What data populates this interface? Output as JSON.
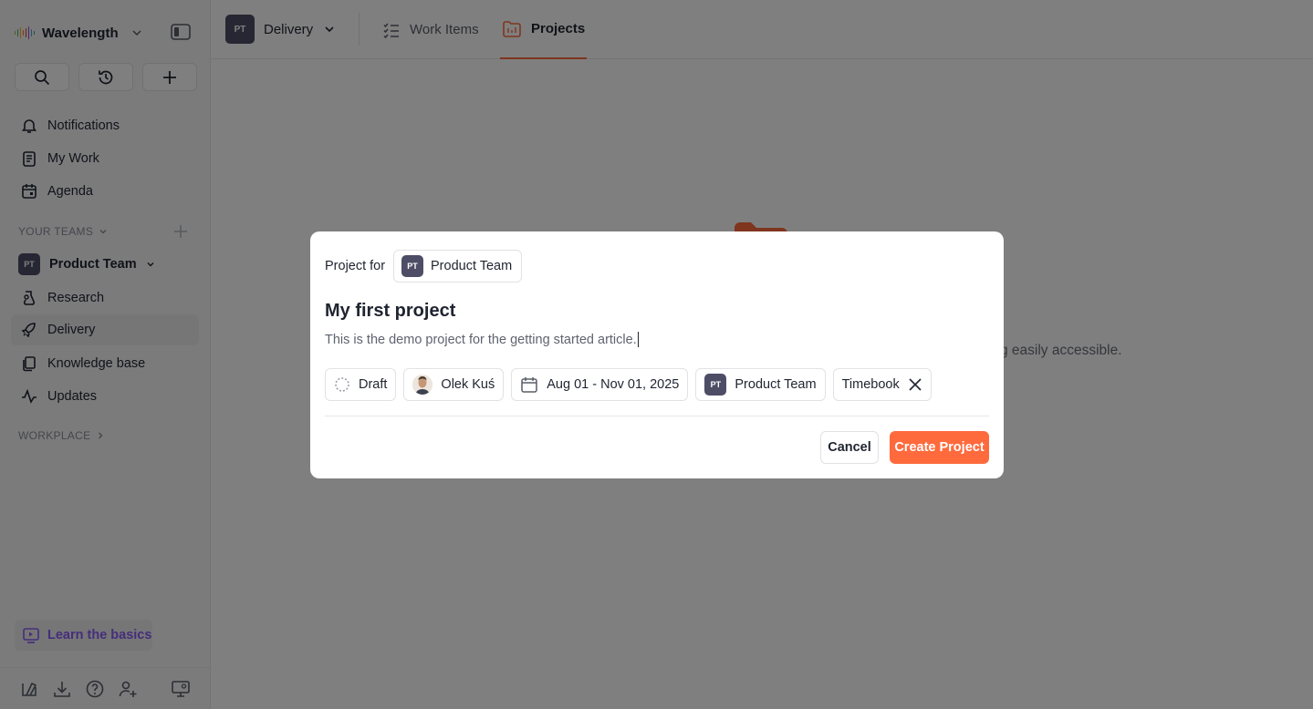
{
  "workspace": {
    "name": "Wavelength"
  },
  "sidebar": {
    "nav": [
      {
        "label": "Notifications"
      },
      {
        "label": "My Work"
      },
      {
        "label": "Agenda"
      }
    ],
    "your_teams_label": "YOUR TEAMS",
    "team": {
      "badge": "PT",
      "name": "Product Team"
    },
    "team_items": [
      {
        "label": "Research"
      },
      {
        "label": "Delivery"
      },
      {
        "label": "Knowledge base"
      },
      {
        "label": "Updates"
      }
    ],
    "workplace_label": "WORKPLACE",
    "learn_label": "Learn the basics"
  },
  "topbar": {
    "team_badge": "PT",
    "team_name": "Delivery",
    "tabs": [
      {
        "label": "Work Items"
      },
      {
        "label": "Projects"
      }
    ]
  },
  "main": {
    "empty_text_visible": "g easily accessible."
  },
  "modal": {
    "project_for_label": "Project for",
    "project_for_badge": "PT",
    "project_for_team": "Product Team",
    "title": "My first project",
    "description": "This is the demo project for the getting started article.",
    "chips": {
      "status": "Draft",
      "assignee": "Olek Kuś",
      "dates": "Aug 01 - Nov 01, 2025",
      "team_badge": "PT",
      "team": "Product Team",
      "timebook": "Timebook"
    },
    "cancel_label": "Cancel",
    "create_label": "Create Project"
  },
  "colors": {
    "accent": "#ff6a3d",
    "team_badge": "#4e4d66",
    "learn": "#8b5cf6"
  }
}
